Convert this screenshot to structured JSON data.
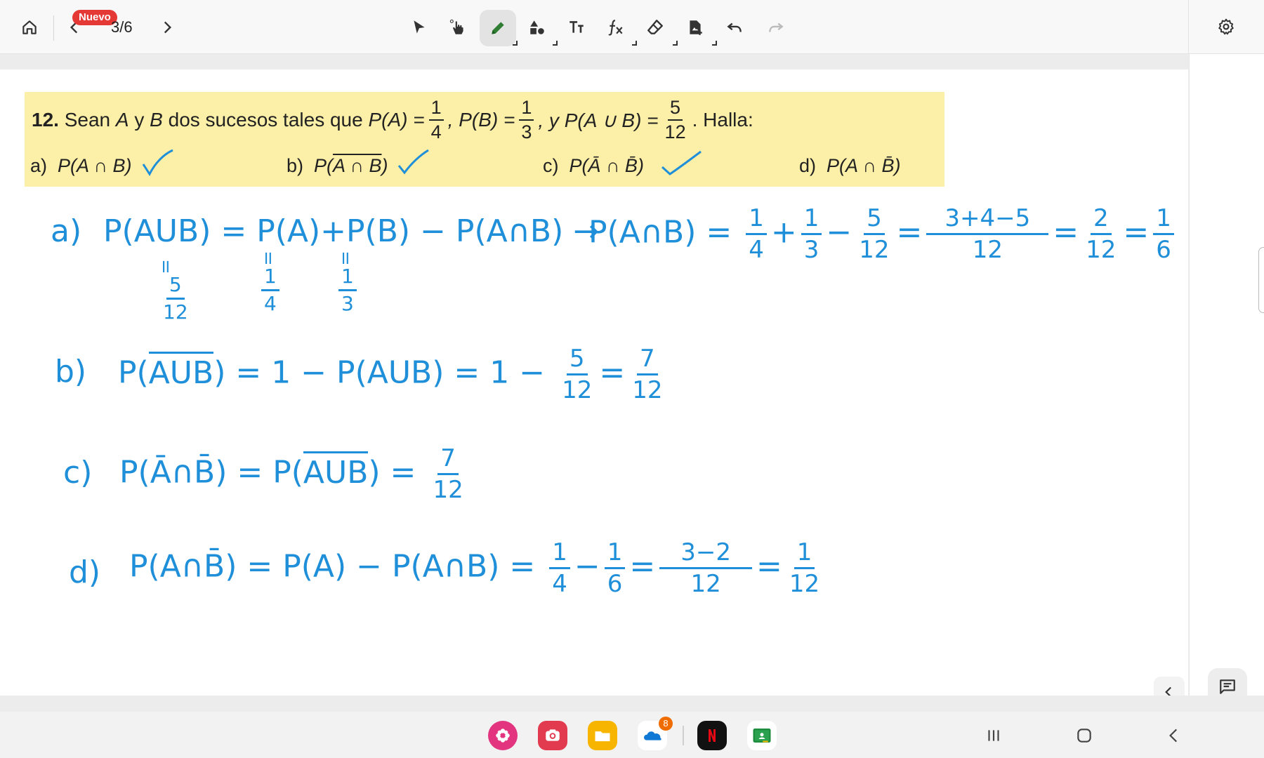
{
  "toolbar": {
    "page_indicator": "3/6",
    "new_badge": "Nuevo"
  },
  "problem": {
    "number": "12.",
    "intro": "Sean",
    "event_a": "A",
    "connector": "y",
    "event_b": "B",
    "rest": "dos sucesos tales que",
    "pa_label": "P(A) =",
    "pa_num": "1",
    "pa_den": "4",
    "pb_label": ", P(B) =",
    "pb_num": "1",
    "pb_den": "3",
    "pu_label": ", y P(A ∪ B) =",
    "pu_num": "5",
    "pu_den": "12",
    "halla": ". Halla:",
    "parts": [
      {
        "letter": "a)",
        "expr_before": "P(A ∩ B)",
        "expr_over": "",
        "expr_after": ""
      },
      {
        "letter": "b)",
        "expr_before": "P(",
        "expr_over": "A ∩ B",
        "expr_after": ")"
      },
      {
        "letter": "c)",
        "expr_before": "P(Ā ∩ B̄)",
        "expr_over": "",
        "expr_after": ""
      },
      {
        "letter": "d)",
        "expr_before": "P(A ∩ B̄)",
        "expr_over": "",
        "expr_after": ""
      }
    ]
  },
  "solution": {
    "a": {
      "label": "a)",
      "eq1": "P(AUB) = P(A)+P(B) − P(A∩B) →",
      "eq2": "P(A∩B) =",
      "f1n": "1",
      "f1d": "4",
      "plus": "+",
      "f2n": "1",
      "f2d": "3",
      "minus": "−",
      "f3n": "5",
      "f3d": "12",
      "eq": "=",
      "f4n": "3+4−5",
      "f4d": "12",
      "eq2b": "=",
      "f5n": "2",
      "f5d": "12",
      "eq3": "=",
      "f6n": "1",
      "f6d": "6",
      "sub1n": "5",
      "sub1d": "12",
      "sub2n": "1",
      "sub2d": "4",
      "sub3n": "1",
      "sub3d": "3",
      "eqmark": "॥"
    },
    "b": {
      "label": "b)",
      "pre": "P(",
      "over": "AUB",
      "post": ") = 1 − P(AUB) = 1 −",
      "f1n": "5",
      "f1d": "12",
      "eq": "=",
      "f2n": "7",
      "f2d": "12"
    },
    "c": {
      "label": "c)",
      "pre": "P(Ā∩B̄) = P(",
      "over": "AUB",
      "post": ") =",
      "f1n": "7",
      "f1d": "12"
    },
    "d": {
      "label": "d)",
      "pre": "P(A∩B̄) = P(A) − P(A∩B) =",
      "f1n": "1",
      "f1d": "4",
      "minus": "−",
      "f2n": "1",
      "f2d": "6",
      "eq": "=",
      "f3n": "3−2",
      "f3d": "12",
      "eq2": "=",
      "f4n": "1",
      "f4d": "12"
    }
  },
  "dock": {
    "onedrive_badge": "8"
  },
  "colors": {
    "ink": "#1e8fd8",
    "highlight": "#fcefa7",
    "badge": "#e53935"
  }
}
